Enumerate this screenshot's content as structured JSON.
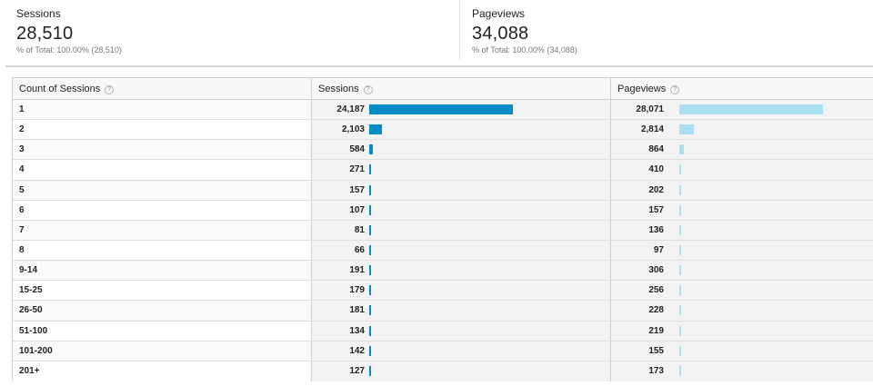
{
  "summary": {
    "sessions": {
      "label": "Sessions",
      "value": "28,510",
      "sub": "% of Total: 100.00% (28,510)"
    },
    "pageviews": {
      "label": "Pageviews",
      "value": "34,088",
      "sub": "% of Total: 100.00% (34,088)"
    }
  },
  "table": {
    "headers": {
      "count": "Count of Sessions",
      "sessions": "Sessions",
      "pageviews": "Pageviews"
    },
    "help_glyph": "?",
    "colors": {
      "sessions_bar": "#058dc7",
      "pageviews_bar": "#aadff3"
    },
    "rows": [
      {
        "label": "1",
        "sessions": "24,187",
        "pageviews": "28,071",
        "s": 24187,
        "p": 28071
      },
      {
        "label": "2",
        "sessions": "2,103",
        "pageviews": "2,814",
        "s": 2103,
        "p": 2814
      },
      {
        "label": "3",
        "sessions": "584",
        "pageviews": "864",
        "s": 584,
        "p": 864
      },
      {
        "label": "4",
        "sessions": "271",
        "pageviews": "410",
        "s": 271,
        "p": 410
      },
      {
        "label": "5",
        "sessions": "157",
        "pageviews": "202",
        "s": 157,
        "p": 202
      },
      {
        "label": "6",
        "sessions": "107",
        "pageviews": "157",
        "s": 107,
        "p": 157
      },
      {
        "label": "7",
        "sessions": "81",
        "pageviews": "136",
        "s": 81,
        "p": 136
      },
      {
        "label": "8",
        "sessions": "66",
        "pageviews": "97",
        "s": 66,
        "p": 97
      },
      {
        "label": "9-14",
        "sessions": "191",
        "pageviews": "306",
        "s": 191,
        "p": 306
      },
      {
        "label": "15-25",
        "sessions": "179",
        "pageviews": "256",
        "s": 179,
        "p": 256
      },
      {
        "label": "26-50",
        "sessions": "181",
        "pageviews": "228",
        "s": 181,
        "p": 228
      },
      {
        "label": "51-100",
        "sessions": "134",
        "pageviews": "219",
        "s": 134,
        "p": 219
      },
      {
        "label": "101-200",
        "sessions": "142",
        "pageviews": "155",
        "s": 142,
        "p": 155
      },
      {
        "label": "201+",
        "sessions": "127",
        "pageviews": "173",
        "s": 127,
        "p": 173
      }
    ]
  }
}
